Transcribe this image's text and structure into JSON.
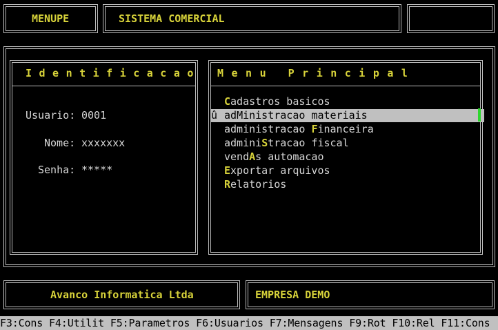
{
  "header": {
    "left_label": "MENUPE",
    "title": "SISTEMA COMERCIAL"
  },
  "identification": {
    "title": "Identificacao",
    "user_label": "Usuario:",
    "user_value": "0001",
    "name_label": "Nome:",
    "name_value": "xxxxxxx",
    "password_label": "Senha:",
    "password_value": "*****"
  },
  "menu": {
    "title": "Menu Principal",
    "selected_index": 1,
    "items": [
      {
        "pre": "",
        "key": "C",
        "post": "adastros basicos"
      },
      {
        "pre": "ad",
        "key": "M",
        "post": "inistracao materiais",
        "marker": "û"
      },
      {
        "pre": "administracao ",
        "key": "F",
        "post": "inanceira"
      },
      {
        "pre": "admini",
        "key": "S",
        "post": "tracao fiscal"
      },
      {
        "pre": "vend",
        "key": "A",
        "post": "s automacao"
      },
      {
        "pre": "",
        "key": "E",
        "post": "xportar arquivos"
      },
      {
        "pre": "",
        "key": "R",
        "post": "elatorios"
      }
    ]
  },
  "footer": {
    "company": "Avanco Informatica Ltda",
    "client": "EMPRESA DEMO"
  },
  "statusbar": {
    "text": "F3:Cons F4:Utilit F5:Parametros F6:Usuarios F7:Mensagens F9:Rot F10:Rel F11:Cons"
  },
  "colors": {
    "background": "#000000",
    "accent_yellow": "#d8d33a",
    "text": "#d6d6d6",
    "highlight": "#c0c0c0",
    "cursor": "#2ed62e"
  }
}
